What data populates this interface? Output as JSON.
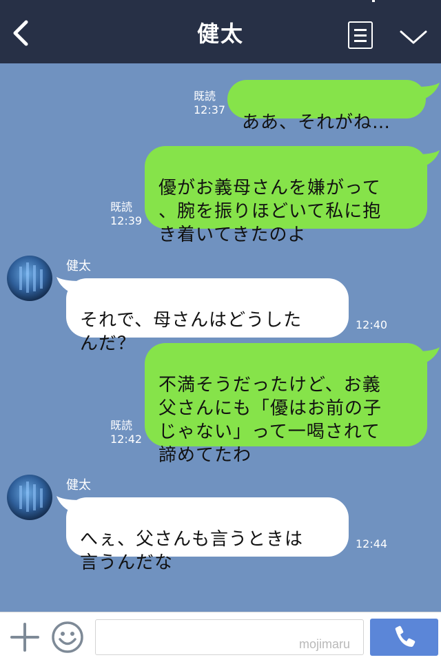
{
  "header": {
    "title": "健太",
    "back_icon": "chevron-left-icon",
    "menu_icon": "note-icon",
    "collapse_icon": "chevron-down-icon"
  },
  "messages": [
    {
      "type": "out",
      "text": "ああ、それがね…",
      "read": "既読",
      "time": "12:37"
    },
    {
      "type": "out",
      "text": "優がお義母さんを嫌がって\n、腕を振りほどいて私に抱\nき着いてきたのよ",
      "read": "既読",
      "time": "12:39"
    },
    {
      "type": "in",
      "sender": "健太",
      "text": "それで、母さんはどうした\nんだ？",
      "time": "12:40"
    },
    {
      "type": "out",
      "text": "不満そうだったけど、お義\n父さんにも「優はお前の子\nじゃない」って一喝されて\n諦めてたわ",
      "read": "既読",
      "time": "12:42"
    },
    {
      "type": "in",
      "sender": "健太",
      "text": "へぇ、父さんも言うときは\n言うんだな",
      "time": "12:44"
    }
  ],
  "footer": {
    "input_placeholder": "",
    "watermark": "mojimaru",
    "plus_icon": "plus-icon",
    "emoji_icon": "smiley-icon",
    "call_icon": "phone-icon"
  },
  "colors": {
    "header_bg": "#273046",
    "chat_bg": "#7092c0",
    "outgoing_bubble": "#86e34a",
    "incoming_bubble": "#ffffff",
    "call_button": "#5b86d8"
  }
}
